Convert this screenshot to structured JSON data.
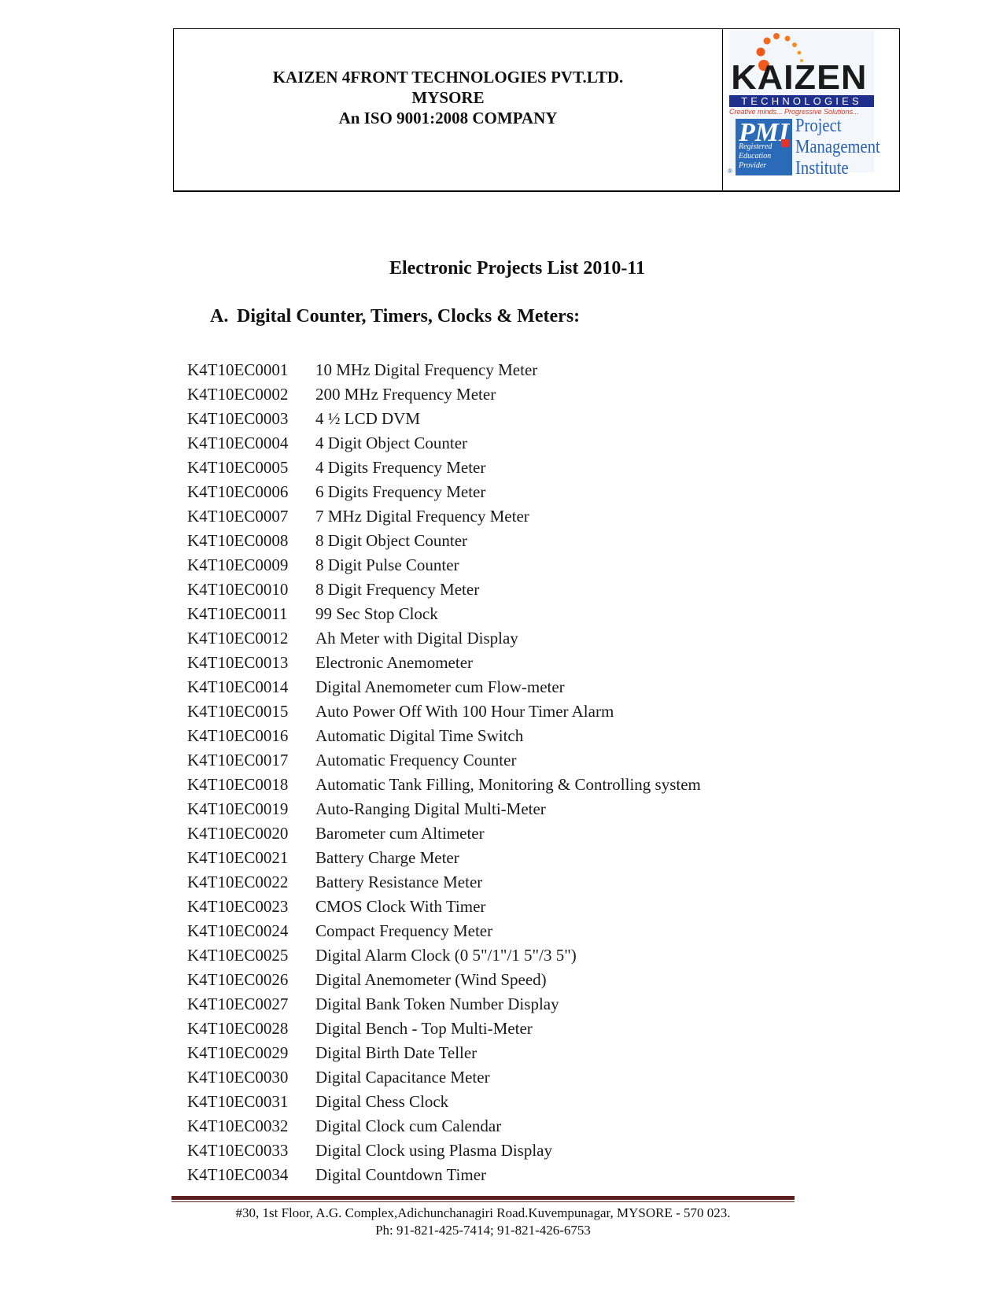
{
  "header": {
    "company_name": "KAIZEN 4FRONT TECHNOLOGIES PVT.LTD.",
    "city": "MYSORE",
    "certification": "An ISO 9001:2008 COMPANY",
    "logo": {
      "brand": "KAIZEN",
      "brand_subtitle": "TECHNOLOGIES",
      "tagline": "Creative minds... Progressive Solutions...",
      "pmi_mark": "PMI",
      "pmi_badge_lines": [
        "Registered",
        "Education",
        "Provider"
      ],
      "pmi_name_lines": [
        "Project",
        "Management",
        "Institute"
      ],
      "registered_symbol": "®",
      "colors": {
        "brand_bar": "#1f2f8c",
        "tagline": "#d23b22",
        "pmi_blue": "#2a6ab8",
        "pmi_red": "#e5322d",
        "dots": "#f15a1a"
      }
    }
  },
  "document": {
    "title": "Electronic Projects List 2010-11",
    "section": {
      "letter": "A.",
      "heading": "Digital Counter, Timers, Clocks & Meters:"
    },
    "projects": [
      {
        "code": "K4T10EC0001",
        "name": "10 MHz Digital Frequency Meter"
      },
      {
        "code": "K4T10EC0002",
        "name": "200 MHz Frequency Meter"
      },
      {
        "code": "K4T10EC0003",
        "name": "4 ½ LCD DVM"
      },
      {
        "code": "K4T10EC0004",
        "name": "4 Digit Object Counter"
      },
      {
        "code": "K4T10EC0005",
        "name": "4 Digits Frequency Meter"
      },
      {
        "code": "K4T10EC0006",
        "name": "6 Digits Frequency Meter"
      },
      {
        "code": "K4T10EC0007",
        "name": "7 MHz Digital Frequency Meter"
      },
      {
        "code": "K4T10EC0008",
        "name": "8 Digit Object Counter"
      },
      {
        "code": "K4T10EC0009",
        "name": "8 Digit Pulse Counter"
      },
      {
        "code": "K4T10EC0010",
        "name": "8 Digit Frequency Meter"
      },
      {
        "code": "K4T10EC0011",
        "name": "99 Sec Stop Clock"
      },
      {
        "code": "K4T10EC0012",
        "name": "Ah Meter with Digital Display"
      },
      {
        "code": "K4T10EC0013",
        "name": "Electronic Anemometer"
      },
      {
        "code": "K4T10EC0014",
        "name": "Digital Anemometer cum Flow-meter"
      },
      {
        "code": "K4T10EC0015",
        "name": "Auto Power Off With 100 Hour Timer Alarm"
      },
      {
        "code": "K4T10EC0016",
        "name": "Automatic Digital Time Switch"
      },
      {
        "code": "K4T10EC0017",
        "name": "Automatic Frequency Counter"
      },
      {
        "code": "K4T10EC0018",
        "name": "Automatic Tank Filling, Monitoring & Controlling system"
      },
      {
        "code": "K4T10EC0019",
        "name": "Auto-Ranging Digital Multi-Meter"
      },
      {
        "code": "K4T10EC0020",
        "name": "Barometer cum Altimeter"
      },
      {
        "code": "K4T10EC0021",
        "name": "Battery Charge Meter"
      },
      {
        "code": "K4T10EC0022",
        "name": "Battery Resistance Meter"
      },
      {
        "code": "K4T10EC0023",
        "name": "CMOS Clock With Timer"
      },
      {
        "code": "K4T10EC0024",
        "name": "Compact Frequency Meter"
      },
      {
        "code": "K4T10EC0025",
        "name": "Digital Alarm Clock  (0 5\"/1\"/1 5\"/3 5\")"
      },
      {
        "code": "K4T10EC0026",
        "name": "Digital Anemometer (Wind Speed)"
      },
      {
        "code": "K4T10EC0027",
        "name": "Digital Bank Token Number Display"
      },
      {
        "code": "K4T10EC0028",
        "name": "Digital Bench - Top Multi-Meter"
      },
      {
        "code": "K4T10EC0029",
        "name": "Digital Birth Date Teller"
      },
      {
        "code": "K4T10EC0030",
        "name": "Digital Capacitance Meter"
      },
      {
        "code": "K4T10EC0031",
        "name": "Digital Chess Clock"
      },
      {
        "code": "K4T10EC0032",
        "name": "Digital Clock cum Calendar"
      },
      {
        "code": "K4T10EC0033",
        "name": "Digital Clock using Plasma Display"
      },
      {
        "code": "K4T10EC0034",
        "name": "Digital Countdown Timer"
      }
    ]
  },
  "footer": {
    "address": "#30, 1st Floor, A.G. Complex,Adichunchanagiri Road.Kuvempunagar, MYSORE - 570 023.",
    "phone": "Ph: 91-821-425-7414; 91-821-426-6753",
    "rule_color": "#5e2020"
  }
}
